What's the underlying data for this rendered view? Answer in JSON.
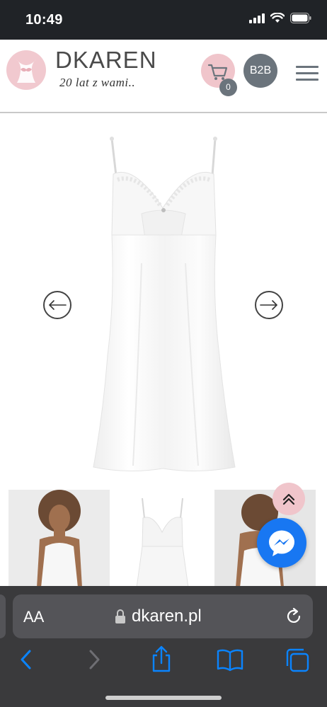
{
  "status_bar": {
    "time": "10:49"
  },
  "header": {
    "brand": "DKAREN",
    "tagline": "20 lat z wami..",
    "cart_count": "0",
    "b2b_label": "B2B"
  },
  "browser": {
    "aa_label": "AA",
    "url": "dkaren.pl"
  },
  "icons": {
    "logo": "logo-icon",
    "cart": "cart-icon",
    "menu": "hamburger-icon",
    "prev": "arrow-left-icon",
    "next": "arrow-right-icon",
    "scroll_top": "chevrons-up-icon",
    "messenger": "messenger-icon",
    "back": "chevron-left-icon",
    "forward": "chevron-right-icon",
    "share": "share-icon",
    "bookmarks": "book-icon",
    "tabs": "tabs-icon"
  },
  "colors": {
    "accent_pink": "#f0c5cb",
    "grey": "#6b747c",
    "safari_blue": "#0a84ff",
    "messenger_blue": "#1877f2"
  }
}
